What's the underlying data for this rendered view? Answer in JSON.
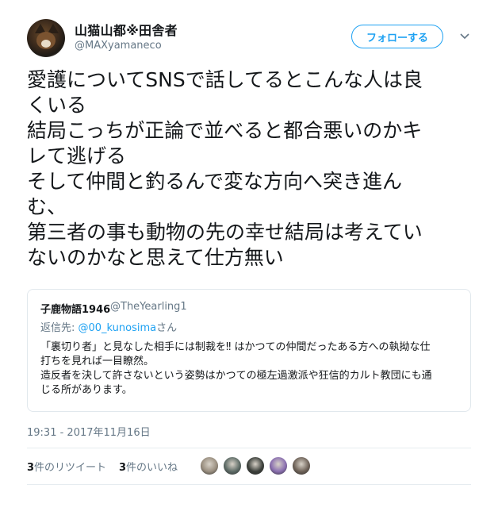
{
  "author": {
    "display_name": "山猫山都※田舎者",
    "screen_name": "@MAXyamaneco"
  },
  "follow_label": "フォローする",
  "tweet_text": "愛護についてSNSで話してるとこんな人は良\nくいる\n結局こっちが正論で並べると都合悪いのかキ\nレて逃げる\nそして仲間と釣るんで変な方向へ突き進ん\nむ、\n第三者の事も動物の先の幸せ結局は考えてい\nないのかなと思えて仕方無い",
  "quote": {
    "name": "子鹿物語1946",
    "handle": "@TheYearling1",
    "reply_prefix": "返信先: ",
    "reply_link": "@00_kunosima",
    "reply_suffix": "さん",
    "body": "「裏切り者」と見なした相手には制裁を‼ はかつての仲間だったある方への執拗な仕\n打ちを見れば一目瞭然。\n造反者を決して許さないという姿勢はかつての極左過激派や狂信的カルト教団にも通\nじる所があります。"
  },
  "timestamp": "19:31 - 2017年11月16日",
  "stats": {
    "retweets_count": "3",
    "retweets_label": "件のリツイート",
    "likes_count": "3",
    "likes_label": "件のいいね"
  },
  "likers": [
    {
      "icon": "cat-avatar",
      "color": "#9a8f80"
    },
    {
      "icon": "animal-avatar",
      "color": "#5d6b66"
    },
    {
      "icon": "door-avatar",
      "color": "#3b3f3a"
    },
    {
      "icon": "flower-avatar",
      "color": "#8a6fb0"
    },
    {
      "icon": "dog-avatar",
      "color": "#6e6258"
    }
  ],
  "colors": {
    "accent": "#1da1f2",
    "secondary_text": "#657786",
    "border": "#e1e8ed"
  }
}
